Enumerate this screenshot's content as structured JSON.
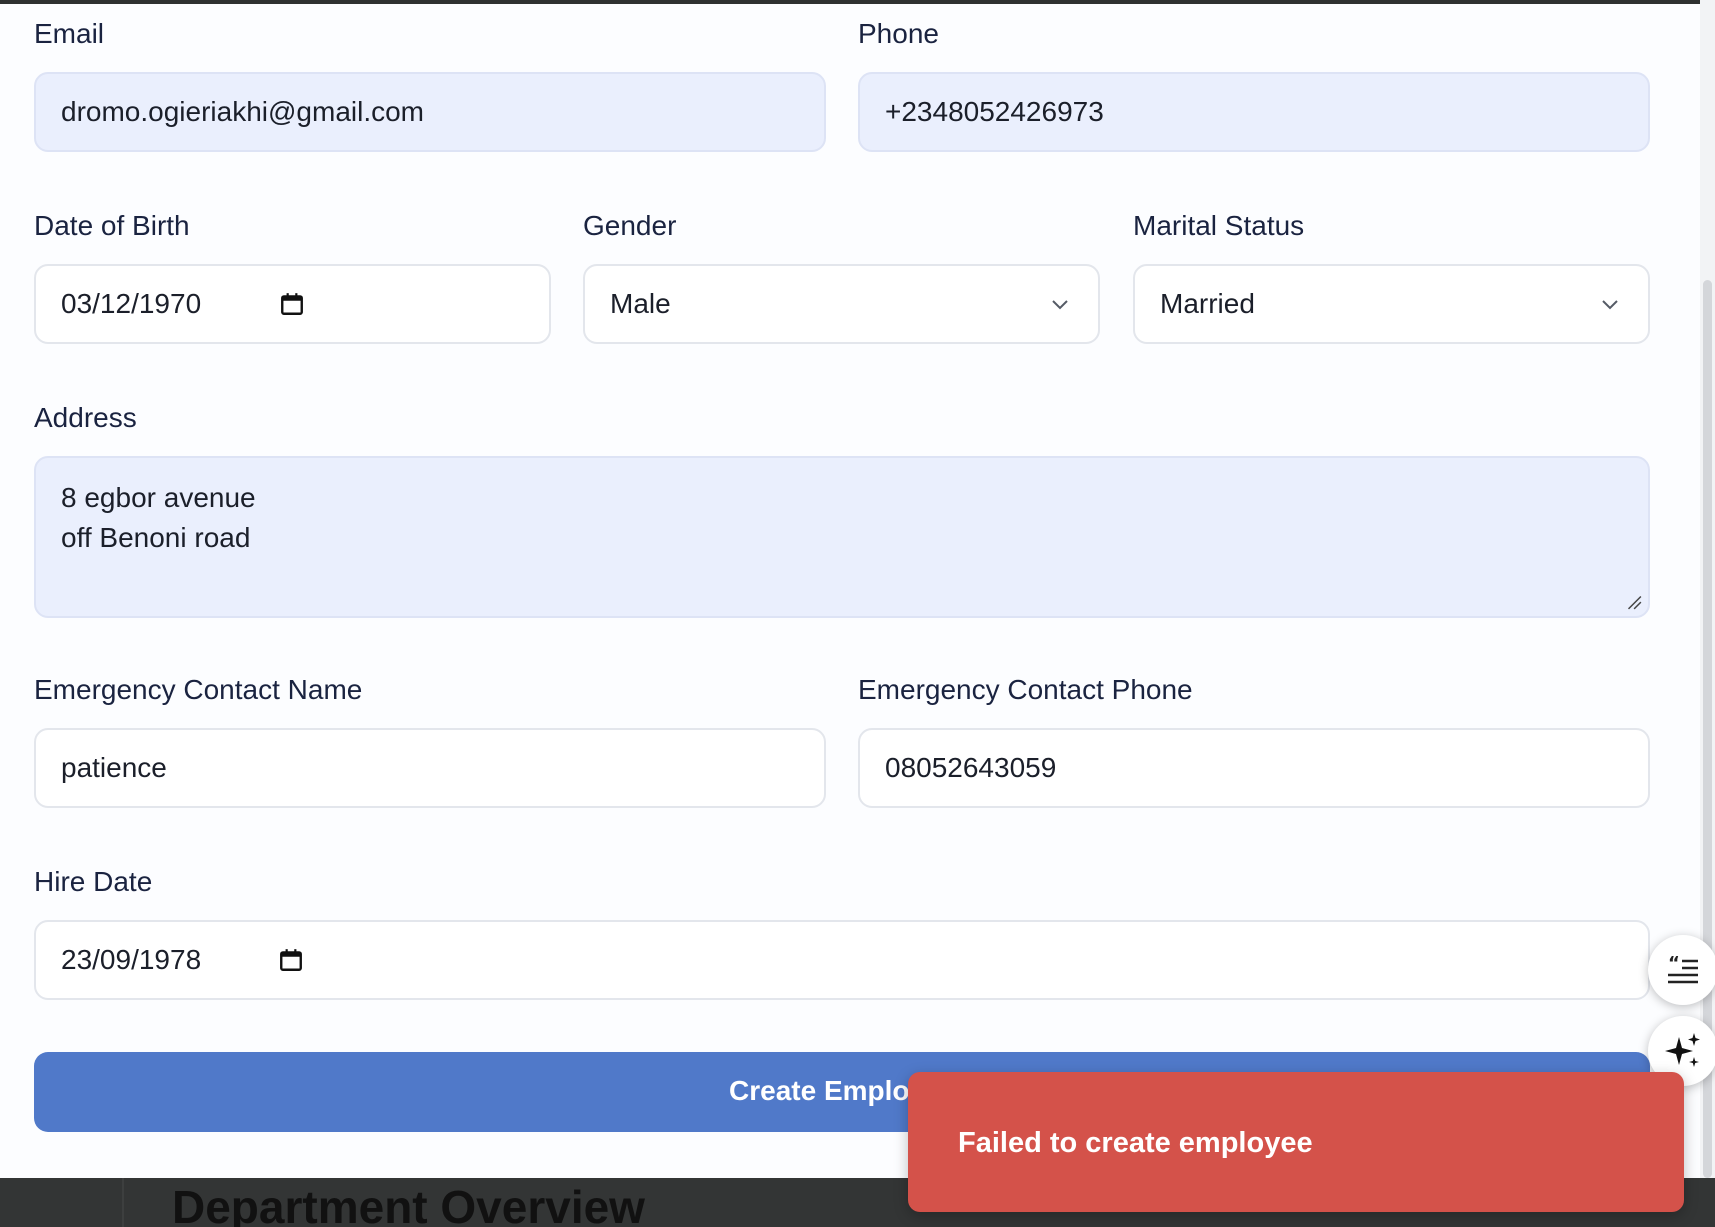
{
  "form": {
    "email": {
      "label": "Email",
      "value": "dromo.ogieriakhi@gmail.com"
    },
    "phone": {
      "label": "Phone",
      "value": "+2348052426973"
    },
    "dob": {
      "label": "Date of Birth",
      "value": "03/12/1970"
    },
    "gender": {
      "label": "Gender",
      "value": "Male"
    },
    "marital": {
      "label": "Marital Status",
      "value": "Married"
    },
    "address": {
      "label": "Address",
      "value": "8 egbor avenue\noff Benoni road"
    },
    "emergency_name": {
      "label": "Emergency Contact Name",
      "value": "patience"
    },
    "emergency_phone": {
      "label": "Emergency Contact Phone",
      "value": "08052643059"
    },
    "hire_date": {
      "label": "Hire Date",
      "value": "23/09/1978"
    },
    "submit_label": "Create Employ"
  },
  "toast": {
    "message": "Failed to create employee"
  },
  "background": {
    "section_title": "Department Overview"
  },
  "floating": {
    "reader_icon": "quote-lines-icon",
    "ai_icon": "sparkles-icon"
  },
  "colors": {
    "primary": "#5079c9",
    "error": "#d4524a",
    "filled_input": "#eaeffd"
  }
}
